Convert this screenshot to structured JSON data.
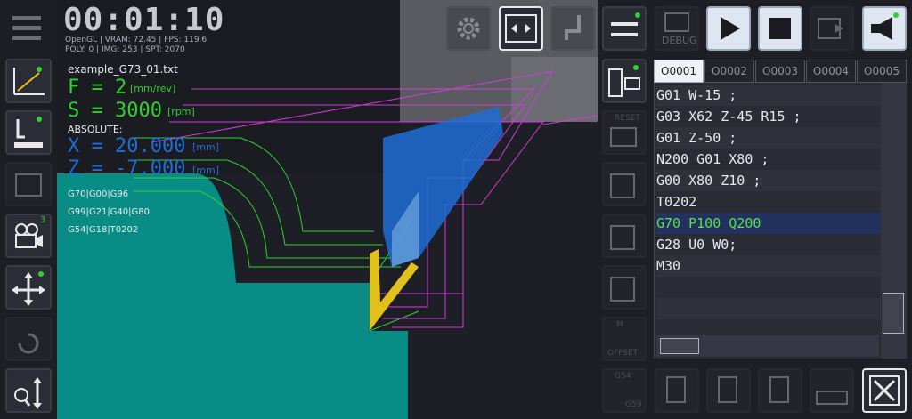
{
  "hud": {
    "timer": "00:01:10",
    "stats1": "OpenGL | VRAM: 72.45 | FPS: 119.6",
    "stats2": "POLY: 0 | IMG: 253 | SPT: 2070",
    "filename": "example_G73_01.txt",
    "feed_label": "F = 2",
    "feed_unit": "[mm/rev]",
    "speed_label": "S = 3000",
    "speed_unit": "[rpm]",
    "mode": "ABSOLUTE:",
    "x_label": "X = 20.000",
    "x_unit": "[mm]",
    "z_label": "Z = -7.000",
    "z_unit": "[mm]",
    "gcodes1": "G70|G00|G96",
    "gcodes2": "G99|G21|G40|G80",
    "gcodes3": "G54|G18|T0202"
  },
  "tabs": [
    "O0001",
    "O0002",
    "O0003",
    "O0004",
    "O0005"
  ],
  "program": {
    "lines": [
      "G01 W-15 ;",
      "G03 X62 Z-45 R15 ;",
      "G01 Z-50 ;",
      "N200 G01 X80 ;",
      "G00 X80 Z10 ;",
      "T0202",
      "G70 P100 Q200",
      "G28 U0 W0;",
      "M30"
    ],
    "current_index": 6
  },
  "toolbar": {
    "debug_label": "DEBUG",
    "reset_label": "RESET",
    "offset_label": "OFFSET",
    "m_label": "M",
    "g54_label": "G54",
    "g59_label": "G59",
    "camera_badge": "3"
  },
  "colors": {
    "workpiece": "#0a8c86",
    "tool": "#e3c11c",
    "toolpath": "#2fd12f",
    "rapid": "#d03cd6",
    "highlight_line": "#23315e",
    "accent_blue": "#1e6dd6"
  }
}
